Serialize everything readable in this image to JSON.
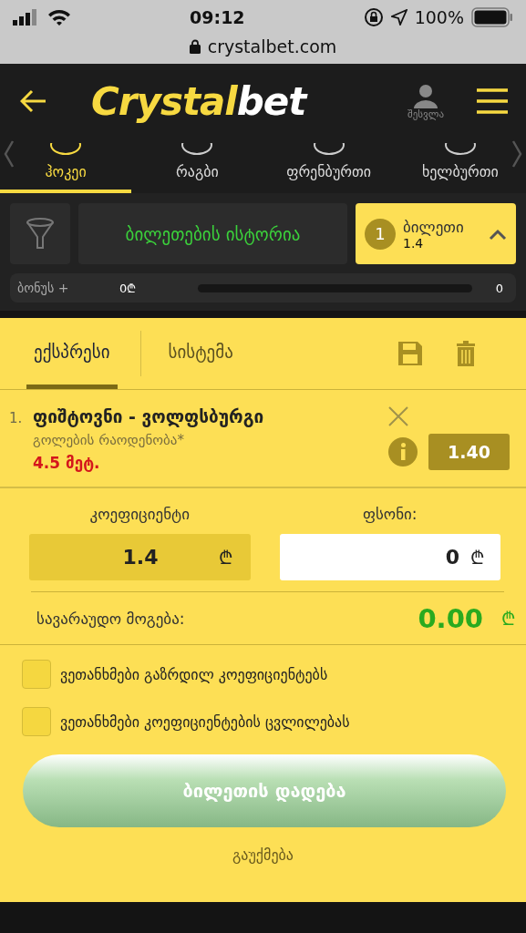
{
  "status_bar": {
    "time": "09:12",
    "battery": "100%",
    "url": "crystalbet.com"
  },
  "header": {
    "logo_part1": "Crystal",
    "logo_part2": "bet",
    "login": "შესვლა"
  },
  "sports": [
    {
      "label": "ჰოკეი",
      "selected": true
    },
    {
      "label": "რაგბი",
      "selected": false
    },
    {
      "label": "ფრენბურთი",
      "selected": false
    },
    {
      "label": "ხელბურთი",
      "selected": false
    }
  ],
  "controls": {
    "history": "ბილეთების ისტორია",
    "ticket_count": "1",
    "ticket_label": "ბილეთი",
    "ticket_odds": "1.4"
  },
  "bonus": {
    "label": "ბონუს +",
    "amount": "0₾",
    "level": 0,
    "value": "0"
  },
  "betslip": {
    "tabs": [
      {
        "label": "ექსპრესი",
        "selected": true
      },
      {
        "label": "სისტემა",
        "selected": false
      }
    ],
    "selections": [
      {
        "number": "1.",
        "match": "ფიშტოვნი - ვოლფსბურგი",
        "market": "გოლების რაოდენობა*",
        "pick": "4.5 მეტ.",
        "odds": "1.40"
      }
    ],
    "odds_label": "კოეფიციენტი",
    "odds_value": "1.4",
    "currency": "₾",
    "stake_label": "ფსონი:",
    "stake_value": "0",
    "win_label": "სავარაუდო მოგება:",
    "win_value": "0.00",
    "options": [
      {
        "label": "ვეთანხმები გაზრდილ კოეფიციენტებს",
        "checked": false
      },
      {
        "label": "ვეთანხმები კოეფიციენტების ცვლილებას",
        "checked": false
      }
    ],
    "place_button": "ბილეთის დადება",
    "cancel": "გაუქმება"
  }
}
